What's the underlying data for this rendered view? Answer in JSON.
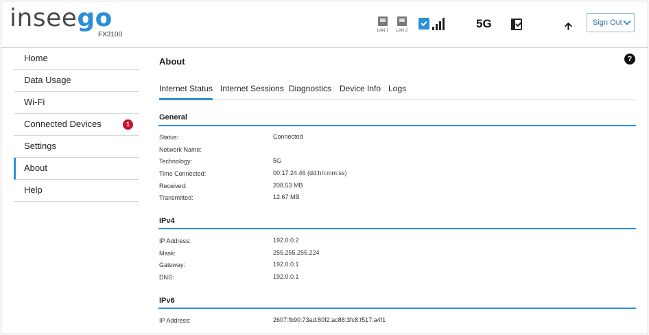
{
  "brand": {
    "logo_a": "insee",
    "logo_b": "go",
    "model": "FX3100"
  },
  "status_bar": {
    "lan1_label": "LAN 1",
    "lan2_label": "LAN 2",
    "network_type": "5G",
    "sign_out_label": "Sign Out",
    "icons": [
      "lan-port-icon",
      "sim-icon",
      "signal-bars-icon",
      "battery-icon",
      "upload-arrow-icon",
      "chevron-down-icon"
    ],
    "signal_level": 0.8
  },
  "sidebar": {
    "items": [
      {
        "label": "Home"
      },
      {
        "label": "Data Usage"
      },
      {
        "label": "Wi-Fi"
      },
      {
        "label": "Connected Devices",
        "badge": "1"
      },
      {
        "label": "Settings"
      },
      {
        "label": "About",
        "active": true
      },
      {
        "label": "Help"
      }
    ]
  },
  "main": {
    "title": "About",
    "help_symbol": "?",
    "tabs": [
      {
        "label": "Internet Status",
        "active": true
      },
      {
        "label": "Internet Sessions"
      },
      {
        "label": "Diagnostics"
      },
      {
        "label": "Device Info"
      },
      {
        "label": "Logs"
      }
    ],
    "sections": {
      "general": {
        "title": "General",
        "rows": [
          {
            "label": "Status:",
            "value": "Connected"
          },
          {
            "label": "Network Name:",
            "value": ""
          },
          {
            "label": "Technology:",
            "value": "5G"
          },
          {
            "label": "Time Connected:",
            "value": "00:17:24:46 (dd:hh:mm:ss)"
          },
          {
            "label": "Received:",
            "value": "208.53 MB"
          },
          {
            "label": "Transmitted:",
            "value": "12.67 MB"
          }
        ]
      },
      "ipv4": {
        "title": "IPv4",
        "rows": [
          {
            "label": "IP Address:",
            "value": "192.0.0.2"
          },
          {
            "label": "Mask:",
            "value": "255.255.255.224"
          },
          {
            "label": "Gateway:",
            "value": "192.0.0.1"
          },
          {
            "label": "DNS:",
            "value": "192.0.0.1"
          }
        ]
      },
      "ipv6": {
        "title": "IPv6",
        "rows": [
          {
            "label": "IP Address:",
            "value": "2607:fb90:73ad:80f2:ac88:3fc8:f517:a4f1"
          }
        ]
      }
    }
  },
  "colors": {
    "accent": "#2a8fd6",
    "badge": "#c8102e",
    "text": "#222222"
  }
}
